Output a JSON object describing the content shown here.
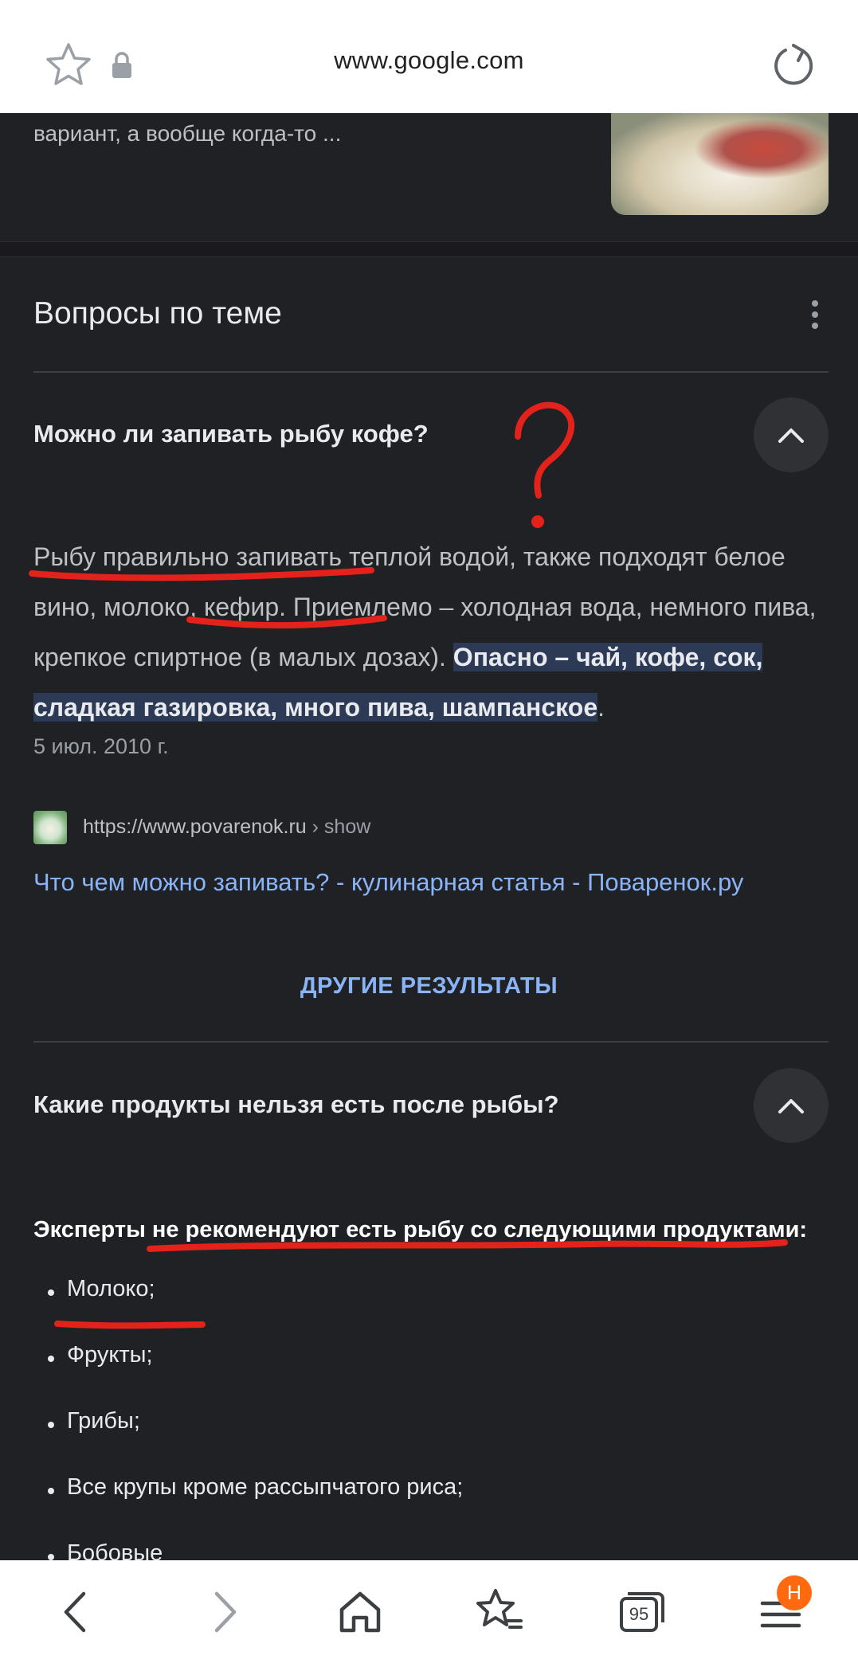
{
  "browser": {
    "url": "www.google.com"
  },
  "snippet_tail": "вариант, а вообще когда-то ...",
  "section": {
    "title": "Вопросы по теме"
  },
  "q1": {
    "question": "Можно ли запивать рыбу кофе?",
    "answer_part1": "Рыбу правильно запивать теплой водой, также подходят белое вино, молоко, кефир. Приемлемо – холодная вода, немного пива, крепкое спиртное (в малых дозах). ",
    "answer_highlight": "Опасно – чай, кофе, сок, сладкая газировка, много пива, шампанское",
    "answer_end": ".",
    "date": "5 июл. 2010 г.",
    "source_url": "https://www.povarenok.ru",
    "source_crumb": " › show",
    "source_title": "Что чем можно запивать? - кулинарная статья - Поваренок.ру"
  },
  "more_results": "ДРУГИЕ РЕЗУЛЬТАТЫ",
  "q2": {
    "question": "Какие продукты нельзя есть после рыбы?",
    "answer_lead": "Эксперты не рекомендуют есть рыбу со следующими продуктами:",
    "items": [
      "Молоко;",
      "Фрукты;",
      "Грибы;",
      "Все крупы кроме рассыпчатого риса;",
      "Бобовые"
    ]
  },
  "tabs_count": "95",
  "menu_badge": "H",
  "annotation_color": "#e3221b"
}
